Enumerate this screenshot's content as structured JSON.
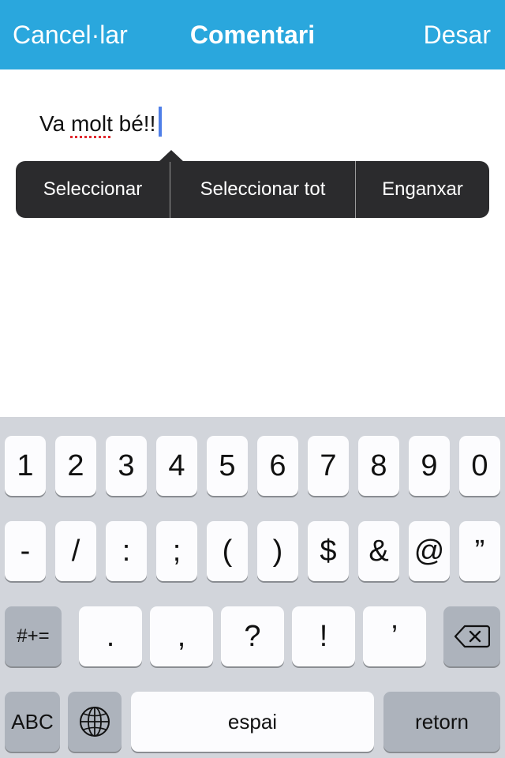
{
  "navbar": {
    "cancel_label": "Cancel·lar",
    "title": "Comentari",
    "save_label": "Desar"
  },
  "editor": {
    "text_before": "Va ",
    "misspelled_word": "molt",
    "text_after": " bé!!"
  },
  "edit_menu": {
    "items": [
      "Seleccionar",
      "Seleccionar tot",
      "Enganxar"
    ]
  },
  "keyboard": {
    "row1": [
      "1",
      "2",
      "3",
      "4",
      "5",
      "6",
      "7",
      "8",
      "9",
      "0"
    ],
    "row2": [
      "-",
      "/",
      ":",
      ";",
      "(",
      ")",
      "$",
      "&",
      "@",
      "”"
    ],
    "row3": {
      "mode_key": "#+=",
      "keys": [
        ".",
        ",",
        "?",
        "!",
        "’"
      ],
      "delete_icon": "backspace-icon"
    },
    "row4": {
      "abc_key": "ABC",
      "globe_icon": "globe-icon",
      "space_key": "espai",
      "return_key": "retorn"
    }
  },
  "colors": {
    "navbar": "#2aa7dd",
    "caret": "#4f7fe8",
    "menu_bg": "#2b2b2d",
    "keyboard_bg": "#d2d5db",
    "spell_underline": "#e0292e"
  }
}
